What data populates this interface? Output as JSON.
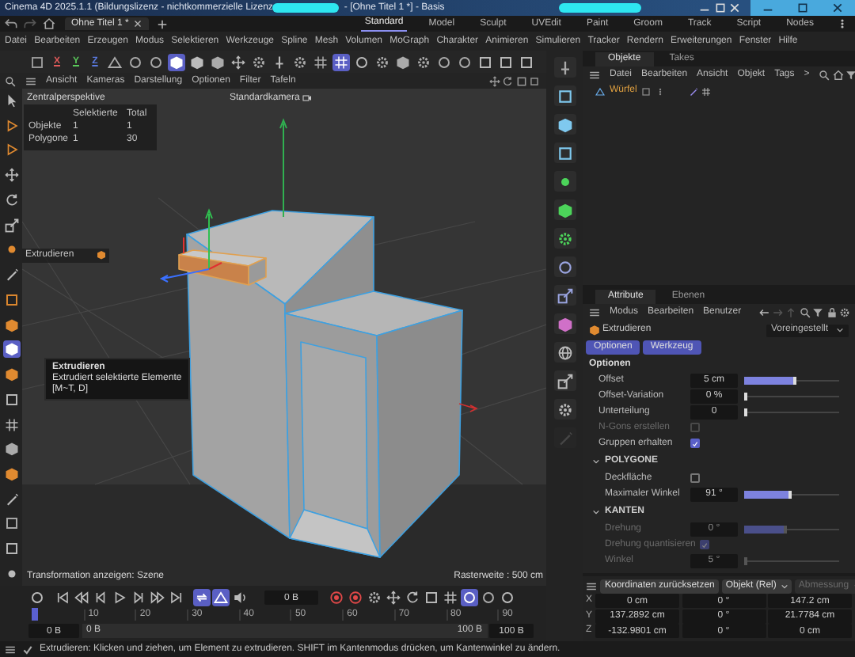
{
  "window": {
    "title": "Cinema 4D 2025.1.1 (Bildungslizenz - nichtkommerzielle Lizenz",
    "title_suffix": "- [Ohne Titel 1 *] - Basis"
  },
  "document_tabs": [
    {
      "label": "Ohne Titel 1 *",
      "selected": true
    }
  ],
  "layout_tabs": [
    {
      "label": "Standard",
      "selected": true
    },
    {
      "label": "Model",
      "selected": false
    },
    {
      "label": "Sculpt",
      "selected": false
    },
    {
      "label": "UVEdit",
      "selected": false
    },
    {
      "label": "Paint",
      "selected": false
    },
    {
      "label": "Groom",
      "selected": false
    },
    {
      "label": "Track",
      "selected": false
    },
    {
      "label": "Script",
      "selected": false
    },
    {
      "label": "Nodes",
      "selected": false
    }
  ],
  "menu": [
    "Datei",
    "Bearbeiten",
    "Erzeugen",
    "Modus",
    "Selektieren",
    "Werkzeuge",
    "Spline",
    "Mesh",
    "Volumen",
    "MoGraph",
    "Charakter",
    "Animieren",
    "Simulieren",
    "Tracker",
    "Rendern",
    "Erweiterungen",
    "Fenster",
    "Hilfe"
  ],
  "main_toolbar": [
    {
      "kind": "icon",
      "selected": false
    },
    {
      "kind": "letter",
      "text": "X",
      "color": "#e05a5a"
    },
    {
      "kind": "letter",
      "text": "Y",
      "color": "#5ac85a"
    },
    {
      "kind": "letter",
      "text": "Z",
      "color": "#5a7ae0"
    },
    {
      "kind": "icon",
      "selected": false
    },
    {
      "kind": "icon",
      "selected": false
    },
    {
      "kind": "icon",
      "selected": false
    },
    {
      "kind": "icon",
      "selected": true
    },
    {
      "kind": "icon",
      "selected": false
    },
    {
      "kind": "icon",
      "selected": false
    },
    {
      "kind": "icon",
      "selected": false
    },
    {
      "kind": "icon",
      "selected": false
    },
    {
      "kind": "icon",
      "selected": false
    },
    {
      "kind": "icon",
      "selected": false
    },
    {
      "kind": "icon",
      "selected": false
    },
    {
      "kind": "icon",
      "selected": true
    },
    {
      "kind": "icon",
      "selected": false
    },
    {
      "kind": "icon",
      "selected": false
    },
    {
      "kind": "icon",
      "selected": false
    },
    {
      "kind": "icon",
      "selected": false
    },
    {
      "kind": "icon",
      "selected": false
    },
    {
      "kind": "icon",
      "selected": false
    },
    {
      "kind": "icon",
      "selected": false
    },
    {
      "kind": "icon",
      "selected": false
    },
    {
      "kind": "icon",
      "selected": false
    }
  ],
  "left_toolbar": [
    {
      "selected": false
    },
    {
      "selected": false
    },
    {
      "selected": false
    },
    {
      "selected": false
    },
    {
      "selected": false
    },
    {
      "selected": false
    },
    {
      "selected": false
    },
    {
      "selected": false
    },
    {
      "selected": false
    },
    {
      "selected": false
    },
    {
      "selected": true
    },
    {
      "selected": false
    },
    {
      "selected": false
    },
    {
      "selected": false
    },
    {
      "selected": false
    },
    {
      "selected": false
    },
    {
      "selected": false
    },
    {
      "selected": false
    },
    {
      "selected": false
    },
    {
      "selected": false
    }
  ],
  "viewport": {
    "menu": [
      "Ansicht",
      "Kameras",
      "Darstellung",
      "Optionen",
      "Filter",
      "Tafeln"
    ],
    "projection": "Zentralperspektive",
    "camera": "Standardkamera",
    "hud": {
      "columns": [
        "Selektierte",
        "Total"
      ],
      "rows": [
        {
          "label": "Objekte",
          "values": [
            "1",
            "1"
          ]
        },
        {
          "label": "Polygone",
          "values": [
            "1",
            "30"
          ]
        }
      ]
    },
    "tool_label": "Extrudieren",
    "tooltip": {
      "title": "Extrudieren",
      "description": "Extrudiert selektierte Elemente",
      "shortcut": "[M~T, D]"
    },
    "transform_info": "Transformation anzeigen: Szene",
    "grid_info": "Rasterweite : 500 cm"
  },
  "timeline": {
    "items": [
      {
        "kind": "icon",
        "selected": false
      },
      {
        "kind": "icon",
        "selected": false
      },
      {
        "kind": "icon",
        "selected": false
      },
      {
        "kind": "icon",
        "selected": false
      },
      {
        "kind": "icon",
        "selected": false
      },
      {
        "kind": "icon",
        "selected": false
      },
      {
        "kind": "icon",
        "selected": false
      },
      {
        "kind": "icon",
        "selected": false
      },
      {
        "kind": "icon",
        "selected": true
      },
      {
        "kind": "icon",
        "selected": true
      },
      {
        "kind": "icon",
        "selected": false
      },
      {
        "kind": "field",
        "value": "0 B"
      },
      {
        "kind": "icon",
        "selected": false
      },
      {
        "kind": "icon",
        "selected": false
      },
      {
        "kind": "icon",
        "selected": false
      },
      {
        "kind": "icon",
        "selected": false
      },
      {
        "kind": "icon",
        "selected": false
      },
      {
        "kind": "icon",
        "selected": false
      },
      {
        "kind": "icon",
        "selected": false
      },
      {
        "kind": "icon",
        "selected": true
      },
      {
        "kind": "icon",
        "selected": false
      },
      {
        "kind": "icon",
        "selected": false
      }
    ],
    "ticks": [
      "10",
      "20",
      "30",
      "40",
      "50",
      "60",
      "70",
      "80",
      "90"
    ],
    "start": "0 B",
    "range_start": "0 B",
    "range_end": "100 B",
    "end": "100 B"
  },
  "palette": [
    {
      "disabled": false
    },
    {
      "disabled": false
    },
    {
      "disabled": false
    },
    {
      "disabled": false
    },
    {
      "disabled": false
    },
    {
      "disabled": false
    },
    {
      "disabled": false
    },
    {
      "disabled": false
    },
    {
      "disabled": false
    },
    {
      "disabled": false
    },
    {
      "disabled": false
    },
    {
      "disabled": false
    },
    {
      "disabled": false
    },
    {
      "disabled": true
    }
  ],
  "objects_panel": {
    "tabs": [
      {
        "label": "Objekte",
        "selected": true
      },
      {
        "label": "Takes",
        "selected": false
      }
    ],
    "menu": [
      "Datei",
      "Bearbeiten",
      "Ansicht",
      "Objekt",
      "Tags",
      ">"
    ],
    "objects": [
      {
        "name": "Würfel",
        "selected": true
      }
    ]
  },
  "attributes_panel": {
    "tabs": [
      {
        "label": "Attribute",
        "selected": true
      },
      {
        "label": "Ebenen",
        "selected": false
      }
    ],
    "menu": [
      "Modus",
      "Bearbeiten",
      "Benutzer"
    ],
    "tool": "Extrudieren",
    "preset": "Voreingestellt",
    "buttons": [
      {
        "label": "Optionen",
        "selected": true
      },
      {
        "label": "Werkzeug",
        "selected": true
      }
    ],
    "heading": "Optionen",
    "rows": [
      {
        "kind": "number",
        "label": "Offset",
        "value": "5 cm",
        "level": 0.55,
        "disabled": false
      },
      {
        "kind": "number",
        "label": "Offset-Variation",
        "value": "0 %",
        "level": 0,
        "disabled": false
      },
      {
        "kind": "number",
        "label": "Unterteilung",
        "value": "0",
        "level": 0,
        "disabled": false
      },
      {
        "kind": "check",
        "label": "N-Gons erstellen",
        "checked": false,
        "disabled": true
      },
      {
        "kind": "check",
        "label": "Gruppen erhalten",
        "checked": true,
        "disabled": false
      },
      {
        "kind": "section",
        "label": "POLYGONE",
        "expanded": true
      },
      {
        "kind": "check",
        "label": "Deckfläche",
        "checked": false,
        "disabled": false
      },
      {
        "kind": "number",
        "label": "Maximaler Winkel",
        "value": "91 °",
        "level": 0.5,
        "disabled": false
      },
      {
        "kind": "section",
        "label": "KANTEN",
        "expanded": true
      },
      {
        "kind": "number",
        "label": "Drehung",
        "value": "0 °",
        "level": 0.45,
        "disabled": true
      },
      {
        "kind": "check",
        "label": "Drehung quantisieren",
        "checked": true,
        "disabled": true
      },
      {
        "kind": "number",
        "label": "Winkel",
        "value": "5 °",
        "level": 0,
        "disabled": true
      }
    ]
  },
  "coordinates": {
    "reset_button": "Koordinaten zurücksetzen",
    "mode": "Objekt (Rel)",
    "size_mode": {
      "label": "Abmessung",
      "disabled": true
    },
    "rows": [
      {
        "axis": "X",
        "values": [
          "0 cm",
          "0 °",
          "147.2 cm"
        ]
      },
      {
        "axis": "Y",
        "values": [
          "137.2892 cm",
          "0 °",
          "21.7784 cm"
        ]
      },
      {
        "axis": "Z",
        "values": [
          "-132.9801 cm",
          "0 °",
          "0 cm"
        ]
      }
    ]
  },
  "status_bar": "Extrudieren: Klicken und ziehen, um Element zu extrudieren. SHIFT im Kantenmodus drücken, um Kantenwinkel zu ändern."
}
